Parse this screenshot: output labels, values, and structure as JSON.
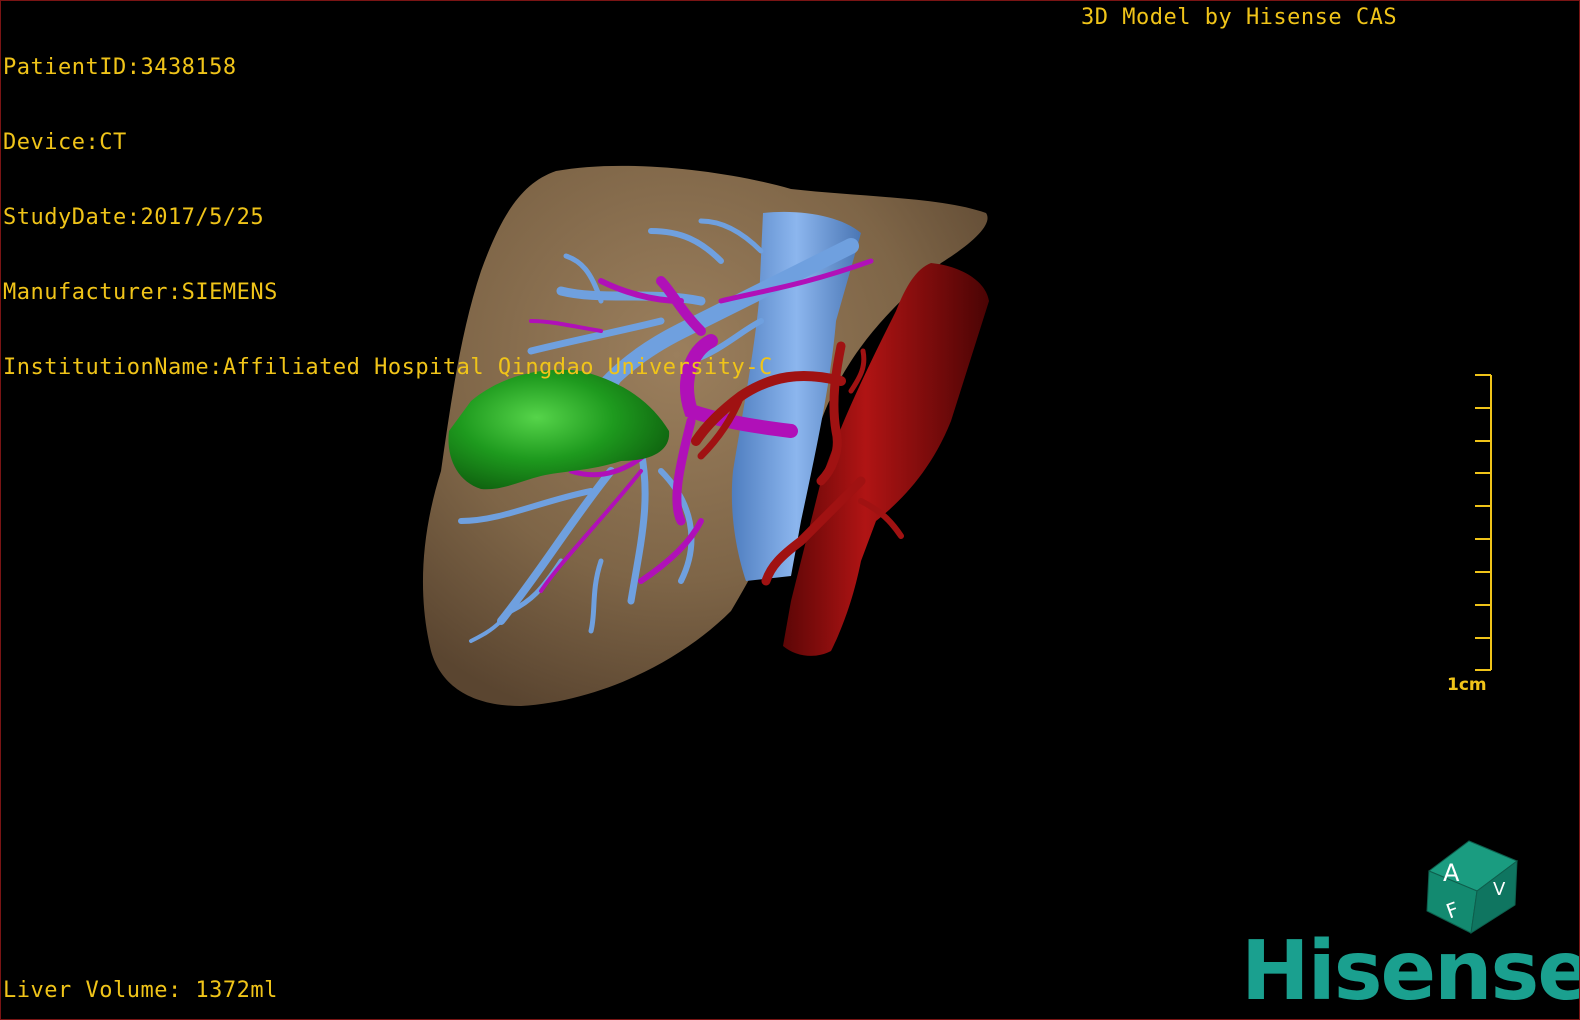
{
  "study_info": {
    "patient_id": "PatientID:3438158",
    "device": "Device:CT",
    "study_date": "StudyDate:2017/5/25",
    "manufacturer": "Manufacturer:SIEMENS",
    "institution": "InstitutionName:Affiliated Hospital Qingdao University-C"
  },
  "model_credit": "3D Model by Hisense CAS",
  "measurements": {
    "liver_volume": "Liver Volume: 1372ml"
  },
  "scale_bar": {
    "label": "1cm",
    "tick_count": 10
  },
  "orientation_cube": {
    "labels": [
      "A",
      "F",
      "V"
    ]
  },
  "brand": {
    "logo_text": "Hisense"
  },
  "colors": {
    "overlay_text": "#f0c419",
    "liver": "#8a7052",
    "portal_vein": "#6fa0df",
    "hepatic_artery": "#b010b8",
    "gallbladder": "#1e9a1e",
    "aorta": "#9a0d0d",
    "ivc": "#7aa8e8",
    "brand": "#1aa08f",
    "cube": "#138a70"
  }
}
